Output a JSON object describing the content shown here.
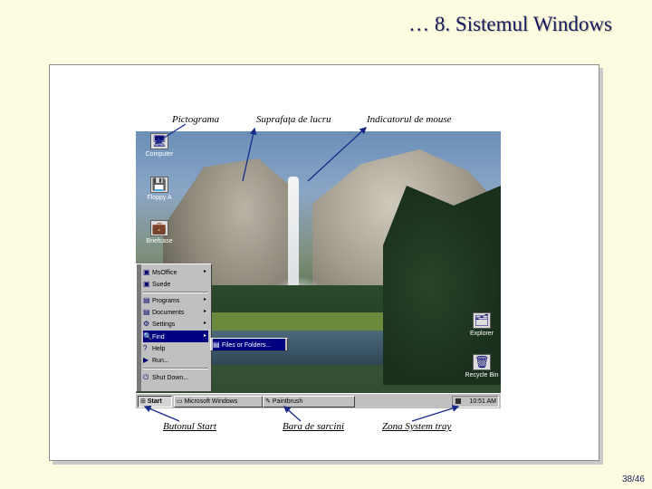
{
  "slide": {
    "title": "… 8. Sistemul Windows",
    "page_number": "38/46"
  },
  "callouts": {
    "icon": "Pictograma",
    "desktop": "Suprafaţa de lucru",
    "pointer": "Indicatorul de mouse",
    "start": "Butonul Start",
    "taskbar": "Bara de sarcini",
    "tray": "Zona System tray"
  },
  "desktop_icons": [
    {
      "label": "Computer",
      "icon": "computer-icon",
      "glyph": "🖥"
    },
    {
      "label": "Floppy A",
      "icon": "floppy-icon",
      "glyph": "💾"
    },
    {
      "label": "Briefcase",
      "icon": "briefcase-icon",
      "glyph": "💼"
    },
    {
      "label": "Explorer",
      "icon": "explorer-icon",
      "glyph": "🗂"
    },
    {
      "label": "Recycle Bin",
      "icon": "recycle-bin-icon",
      "glyph": "🗑"
    }
  ],
  "start_menu": {
    "items": [
      {
        "label": "MsOffice",
        "glyph": "▣",
        "arrow": "▸"
      },
      {
        "label": "Suede",
        "glyph": "▣",
        "arrow": ""
      },
      {
        "label": "Programs",
        "glyph": "▤",
        "arrow": "▸"
      },
      {
        "label": "Documents",
        "glyph": "▤",
        "arrow": "▸"
      },
      {
        "label": "Settings",
        "glyph": "⚙",
        "arrow": "▸"
      },
      {
        "label": "Find",
        "glyph": "🔍",
        "arrow": "▸"
      },
      {
        "label": "Help",
        "glyph": "?",
        "arrow": ""
      },
      {
        "label": "Run...",
        "glyph": "▶",
        "arrow": ""
      },
      {
        "label": "Shut Down...",
        "glyph": "⏻",
        "arrow": ""
      }
    ],
    "submenu": {
      "label": "Files or Folders...",
      "glyph": "▤"
    }
  },
  "taskbar": {
    "start_label": "Start",
    "buttons": [
      "Microsoft Windows",
      "Paintbrush"
    ],
    "clock": "10:51 AM"
  }
}
